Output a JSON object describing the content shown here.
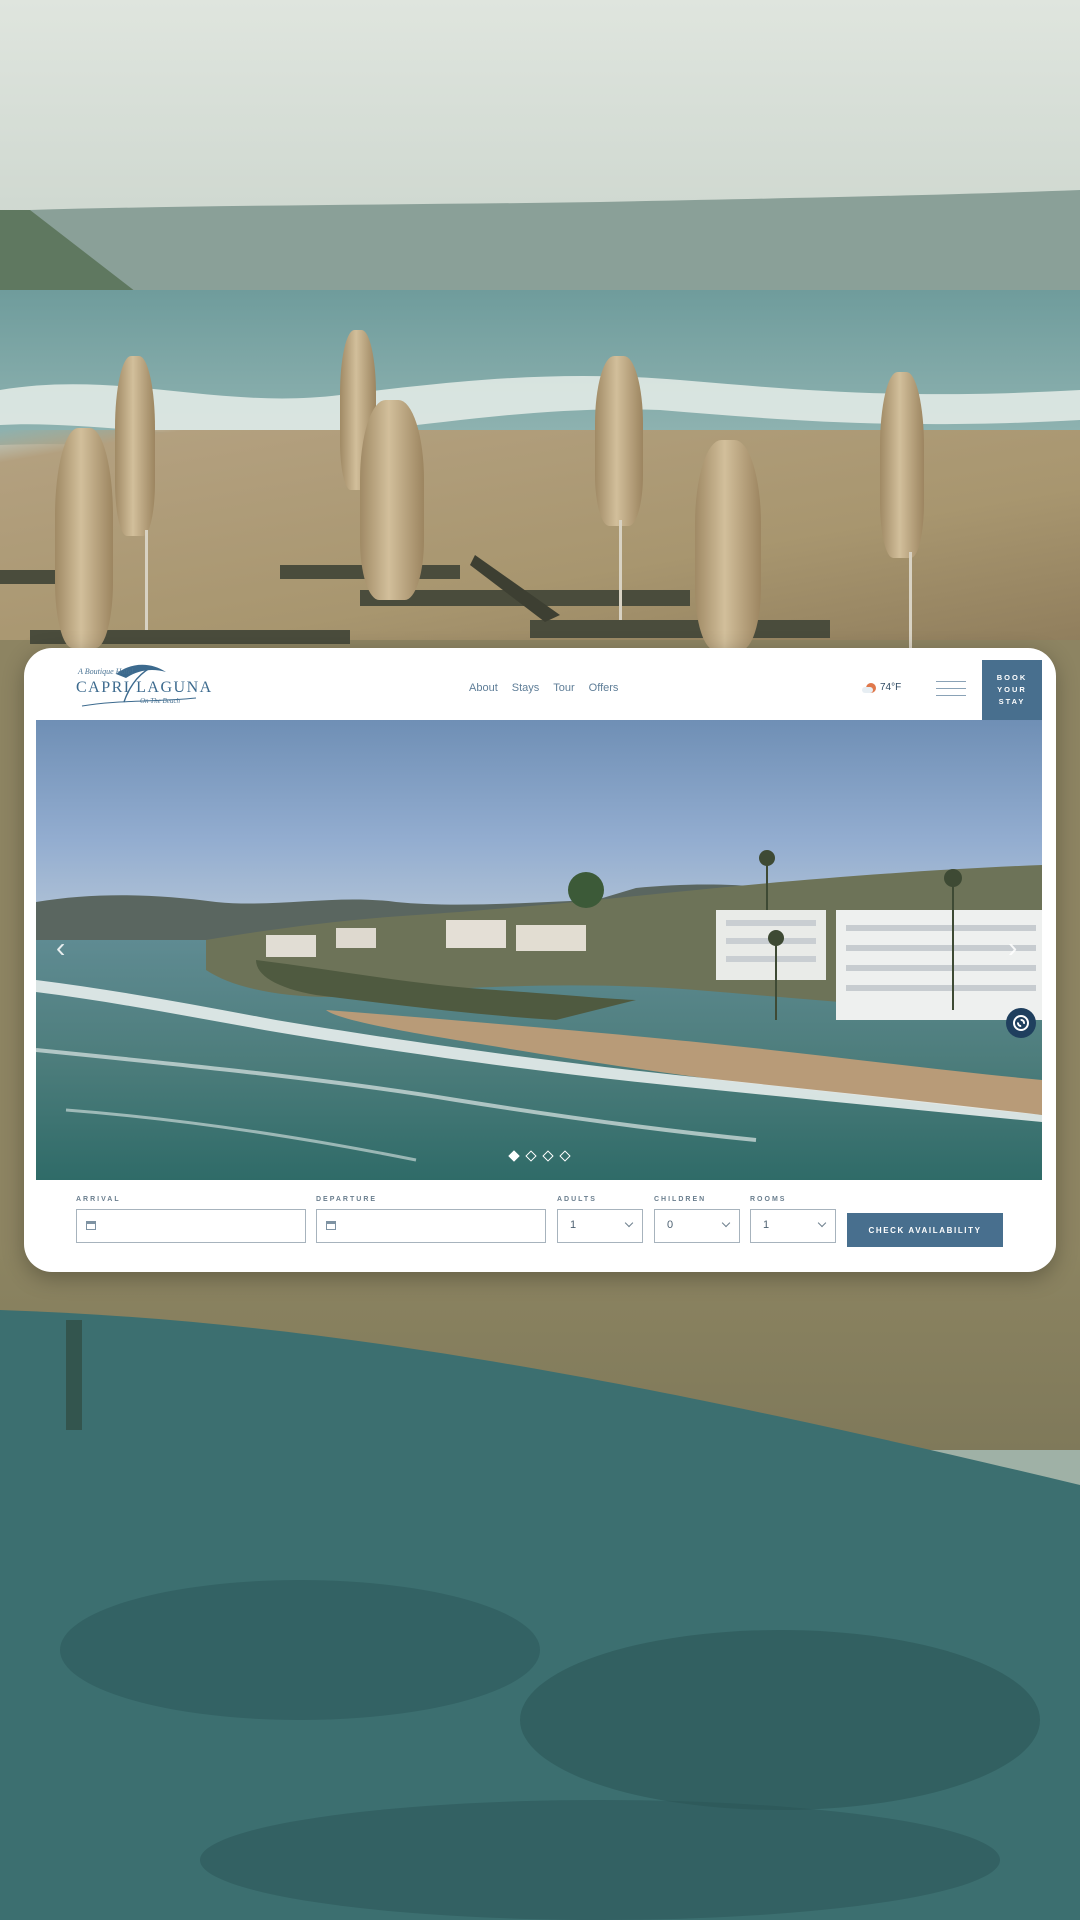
{
  "logo": {
    "tagline": "A Boutique Hotel",
    "name": "CAPRI LAGUNA",
    "subtitle": "On The Beach"
  },
  "nav": {
    "items": [
      "About",
      "Stays",
      "Tour",
      "Offers"
    ]
  },
  "weather": {
    "temperature": "74°F",
    "icon": "partly-sunny-icon"
  },
  "menu": {
    "icon": "hamburger-menu-icon"
  },
  "book_button": {
    "label": "BOOK YOUR STAY"
  },
  "carousel": {
    "prev_icon": "chevron-left-icon",
    "next_icon": "chevron-right-icon",
    "prev_glyph": "‹",
    "next_glyph": "›",
    "slide_count": 4,
    "active_slide": 1
  },
  "help": {
    "icon": "lifebuoy-icon"
  },
  "booking": {
    "arrival": {
      "label": "ARRIVAL",
      "value": ""
    },
    "departure": {
      "label": "DEPARTURE",
      "value": ""
    },
    "adults": {
      "label": "ADULTS",
      "value": "1"
    },
    "children": {
      "label": "CHILDREN",
      "value": "0"
    },
    "rooms": {
      "label": "ROOMS",
      "value": "1"
    },
    "submit_label": "CHECK AVAILABILITY"
  },
  "colors": {
    "brand_blue": "#486f8e",
    "nav_text": "#5f7e98",
    "card_bg": "#ffffff"
  }
}
